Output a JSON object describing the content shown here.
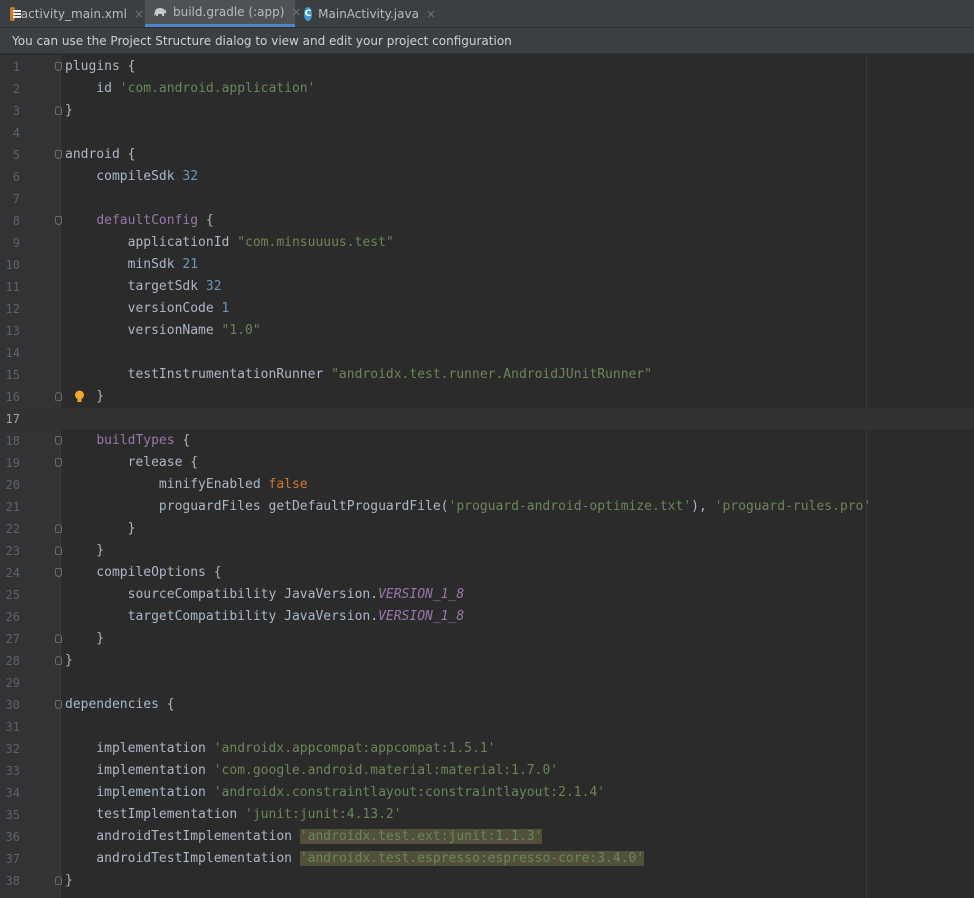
{
  "tabs": [
    {
      "label": "activity_main.xml",
      "icon": "xml-file-icon",
      "active": false
    },
    {
      "label": "build.gradle (:app)",
      "icon": "gradle-elephant-icon",
      "active": true
    },
    {
      "label": "MainActivity.java",
      "icon": "java-class-icon",
      "active": false
    }
  ],
  "tab_close_glyph": "×",
  "banner": {
    "text": "You can use the Project Structure dialog to view and edit your project configuration"
  },
  "editor": {
    "current_line": 17,
    "lines": [
      {
        "n": "1",
        "tokens": [
          {
            "t": "plugins {"
          }
        ]
      },
      {
        "n": "2",
        "tokens": [
          {
            "t": "    id "
          },
          {
            "t": "'com.android.application'",
            "c": "str"
          }
        ]
      },
      {
        "n": "3",
        "tokens": [
          {
            "t": "}"
          }
        ]
      },
      {
        "n": "4",
        "tokens": []
      },
      {
        "n": "5",
        "tokens": [
          {
            "t": "android {"
          }
        ]
      },
      {
        "n": "6",
        "tokens": [
          {
            "t": "    compileSdk "
          },
          {
            "t": "32",
            "c": "num"
          }
        ]
      },
      {
        "n": "7",
        "tokens": []
      },
      {
        "n": "8",
        "tokens": [
          {
            "t": "    "
          },
          {
            "t": "defaultConfig",
            "c": "fn"
          },
          {
            "t": " {"
          }
        ]
      },
      {
        "n": "9",
        "tokens": [
          {
            "t": "        applicationId "
          },
          {
            "t": "\"com.minsuuuus.test\"",
            "c": "str"
          }
        ]
      },
      {
        "n": "10",
        "tokens": [
          {
            "t": "        minSdk "
          },
          {
            "t": "21",
            "c": "num"
          }
        ]
      },
      {
        "n": "11",
        "tokens": [
          {
            "t": "        targetSdk "
          },
          {
            "t": "32",
            "c": "num"
          }
        ]
      },
      {
        "n": "12",
        "tokens": [
          {
            "t": "        versionCode "
          },
          {
            "t": "1",
            "c": "num"
          }
        ]
      },
      {
        "n": "13",
        "tokens": [
          {
            "t": "        versionName "
          },
          {
            "t": "\"1.0\"",
            "c": "str"
          }
        ]
      },
      {
        "n": "14",
        "tokens": []
      },
      {
        "n": "15",
        "tokens": [
          {
            "t": "        testInstrumentationRunner "
          },
          {
            "t": "\"androidx.test.runner.AndroidJUnitRunner\"",
            "c": "str"
          }
        ]
      },
      {
        "n": "16",
        "tokens": [
          {
            "t": "    }"
          }
        ]
      },
      {
        "n": "17",
        "tokens": []
      },
      {
        "n": "18",
        "tokens": [
          {
            "t": "    "
          },
          {
            "t": "buildTypes",
            "c": "fn"
          },
          {
            "t": " {"
          }
        ]
      },
      {
        "n": "19",
        "tokens": [
          {
            "t": "        release {"
          }
        ]
      },
      {
        "n": "20",
        "tokens": [
          {
            "t": "            minifyEnabled "
          },
          {
            "t": "false",
            "c": "kw"
          }
        ]
      },
      {
        "n": "21",
        "tokens": [
          {
            "t": "            proguardFiles getDefaultProguardFile("
          },
          {
            "t": "'proguard-android-optimize.txt'",
            "c": "str"
          },
          {
            "t": "), "
          },
          {
            "t": "'proguard-rules.pro'",
            "c": "str"
          }
        ]
      },
      {
        "n": "22",
        "tokens": [
          {
            "t": "        }"
          }
        ]
      },
      {
        "n": "23",
        "tokens": [
          {
            "t": "    }"
          }
        ]
      },
      {
        "n": "24",
        "tokens": [
          {
            "t": "    compileOptions {"
          }
        ]
      },
      {
        "n": "25",
        "tokens": [
          {
            "t": "        sourceCompatibility JavaVersion."
          },
          {
            "t": "VERSION_1_8",
            "c": "it"
          }
        ]
      },
      {
        "n": "26",
        "tokens": [
          {
            "t": "        targetCompatibility JavaVersion."
          },
          {
            "t": "VERSION_1_8",
            "c": "it"
          }
        ]
      },
      {
        "n": "27",
        "tokens": [
          {
            "t": "    }"
          }
        ]
      },
      {
        "n": "28",
        "tokens": [
          {
            "t": "}"
          }
        ]
      },
      {
        "n": "29",
        "tokens": []
      },
      {
        "n": "30",
        "tokens": [
          {
            "t": "dependencies {"
          }
        ]
      },
      {
        "n": "31",
        "tokens": []
      },
      {
        "n": "32",
        "tokens": [
          {
            "t": "    implementation "
          },
          {
            "t": "'androidx.appcompat:appcompat:1.5.1'",
            "c": "str"
          }
        ]
      },
      {
        "n": "33",
        "tokens": [
          {
            "t": "    implementation "
          },
          {
            "t": "'com.google.android.material:material:1.7.0'",
            "c": "str"
          }
        ]
      },
      {
        "n": "34",
        "tokens": [
          {
            "t": "    implementation "
          },
          {
            "t": "'androidx.constraintlayout:constraintlayout:2.1.4'",
            "c": "str"
          }
        ]
      },
      {
        "n": "35",
        "tokens": [
          {
            "t": "    testImplementation "
          },
          {
            "t": "'junit:junit:4.13.2'",
            "c": "str"
          }
        ]
      },
      {
        "n": "36",
        "tokens": [
          {
            "t": "    androidTestImplementation "
          },
          {
            "t": "'androidx.test.ext:junit:1.1.3'",
            "c": "str",
            "hl": true
          }
        ]
      },
      {
        "n": "37",
        "tokens": [
          {
            "t": "    androidTestImplementation "
          },
          {
            "t": "'androidx.test.espresso:espresso-core:3.4.0'",
            "c": "str",
            "hl": true
          }
        ]
      },
      {
        "n": "38",
        "tokens": [
          {
            "t": "}"
          }
        ]
      }
    ],
    "fold_start_lines": [
      1,
      5,
      8,
      18,
      19,
      24,
      30
    ],
    "fold_end_lines": [
      3,
      16,
      22,
      23,
      27,
      28,
      38
    ],
    "intention_bulb_line": 16
  },
  "colors": {
    "background": "#2b2b2b",
    "text": "#a9b7c6",
    "string": "#6a8759",
    "number": "#6897bb",
    "keyword": "#cc7832",
    "method": "#9876aa",
    "highlight": "#52503a",
    "active_tab_underline": "#4a88c7"
  }
}
